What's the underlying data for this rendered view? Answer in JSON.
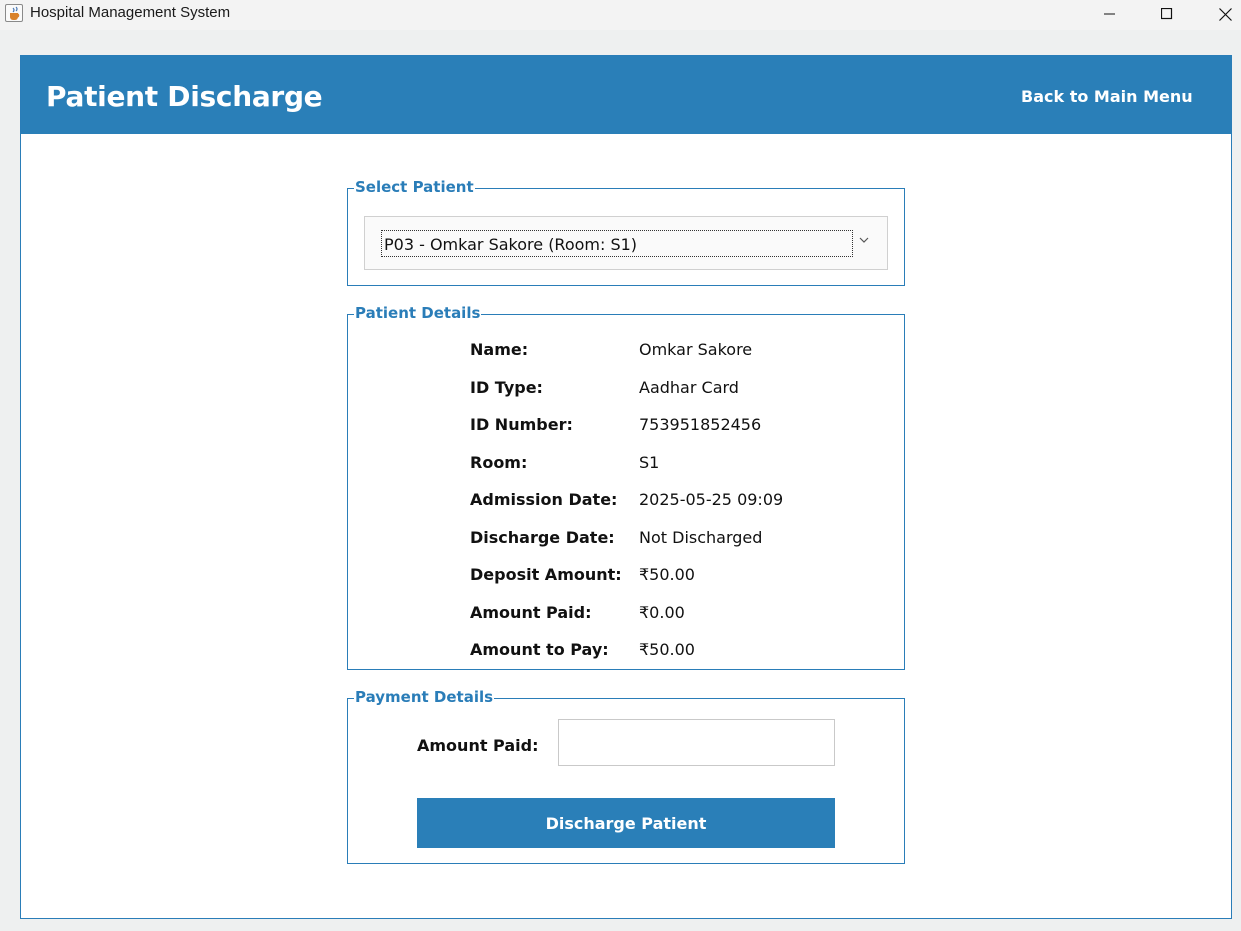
{
  "window": {
    "title": "Hospital Management System",
    "icon": "java-cup-icon"
  },
  "header": {
    "title": "Patient Discharge",
    "back_link": "Back to Main Menu",
    "color": "#2a7fb8"
  },
  "select_patient": {
    "legend": "Select Patient",
    "selected": "P03 - Omkar Sakore (Room: S1)"
  },
  "patient_details": {
    "legend": "Patient Details",
    "rows": [
      {
        "label": "Name:",
        "value": "Omkar Sakore"
      },
      {
        "label": "ID Type:",
        "value": "Aadhar Card"
      },
      {
        "label": "ID Number:",
        "value": "753951852456"
      },
      {
        "label": "Room:",
        "value": "S1"
      },
      {
        "label": "Admission Date:",
        "value": "2025-05-25 09:09"
      },
      {
        "label": "Discharge Date:",
        "value": "Not Discharged"
      },
      {
        "label": "Deposit Amount:",
        "value": "₹50.00"
      },
      {
        "label": "Amount Paid:",
        "value": "₹0.00"
      },
      {
        "label": "Amount to Pay:",
        "value": "₹50.00"
      }
    ]
  },
  "payment": {
    "legend": "Payment Details",
    "amount_label": "Amount Paid:",
    "amount_value": "",
    "button_label": "Discharge Patient"
  }
}
